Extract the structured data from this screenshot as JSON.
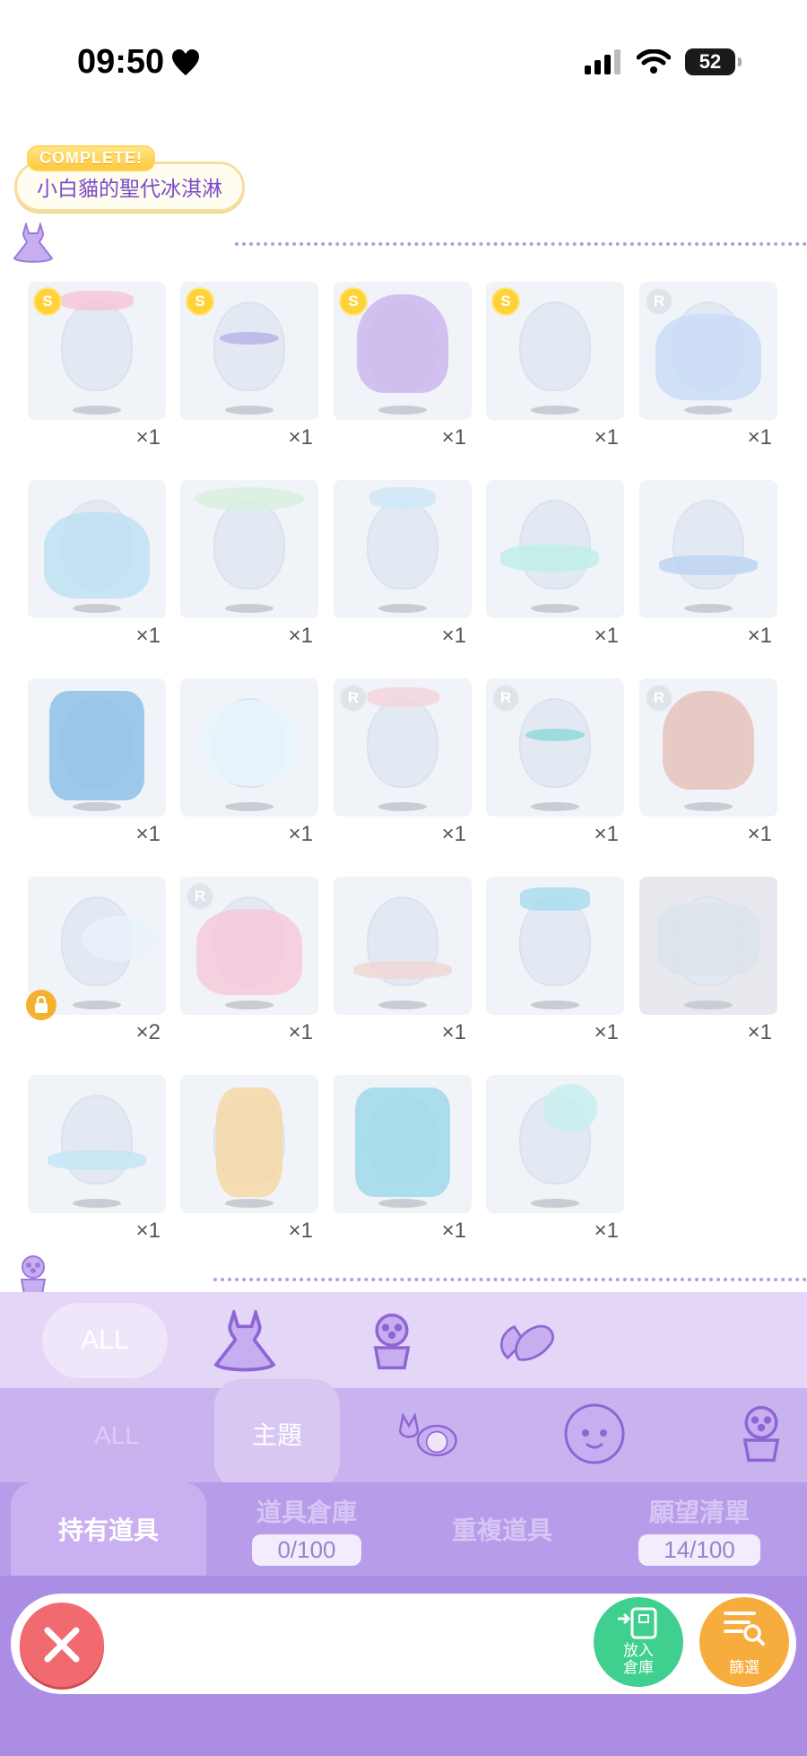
{
  "status": {
    "time": "09:50",
    "battery": "52"
  },
  "set": {
    "complete_label": "COMPLETE!",
    "title": "小白貓的聖代冰淇淋"
  },
  "items": [
    {
      "badge": "S",
      "qty": "×1"
    },
    {
      "badge": "S",
      "qty": "×1"
    },
    {
      "badge": "S",
      "qty": "×1"
    },
    {
      "badge": "S",
      "qty": "×1"
    },
    {
      "badge": "R",
      "qty": "×1"
    },
    {
      "badge": "",
      "qty": "×1"
    },
    {
      "badge": "",
      "qty": "×1"
    },
    {
      "badge": "",
      "qty": "×1"
    },
    {
      "badge": "",
      "qty": "×1"
    },
    {
      "badge": "",
      "qty": "×1"
    },
    {
      "badge": "",
      "qty": "×1"
    },
    {
      "badge": "",
      "qty": "×1"
    },
    {
      "badge": "R",
      "qty": "×1"
    },
    {
      "badge": "R",
      "qty": "×1"
    },
    {
      "badge": "R",
      "qty": "×1"
    },
    {
      "badge": "",
      "qty": "×2",
      "locked": true
    },
    {
      "badge": "R",
      "qty": "×1"
    },
    {
      "badge": "",
      "qty": "×1"
    },
    {
      "badge": "",
      "qty": "×1"
    },
    {
      "badge": "",
      "qty": "×1",
      "dim": true
    },
    {
      "badge": "",
      "qty": "×1"
    },
    {
      "badge": "",
      "qty": "×1"
    },
    {
      "badge": "",
      "qty": "×1"
    },
    {
      "badge": "",
      "qty": "×1"
    }
  ],
  "category_tabs": {
    "all_label": "ALL",
    "icons": [
      "dress-icon",
      "flower-pot-icon",
      "hands-icon"
    ]
  },
  "sub_tabs": {
    "all_label": "ALL",
    "theme_label": "主題",
    "icons": [
      "character-icon",
      "face-icon",
      "flower-pot-icon"
    ]
  },
  "storage_tabs": {
    "owned": "持有道具",
    "warehouse": "道具倉庫",
    "warehouse_count": "0/100",
    "duplicates": "重複道具",
    "wishlist": "願望清單",
    "wishlist_count": "14/100"
  },
  "actions": {
    "store_label_1": "放入",
    "store_label_2": "倉庫",
    "filter_label": "篩選"
  },
  "colors": {
    "accent": "#7a4bc8",
    "panel": "#d8c7f3",
    "gold": "#ffd23a",
    "close": "#f06a6f"
  }
}
